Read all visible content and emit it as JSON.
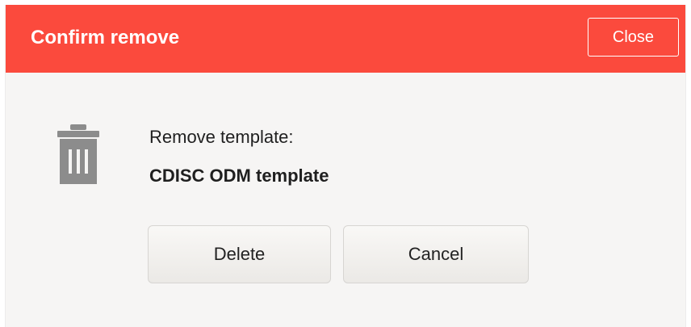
{
  "dialog": {
    "title": "Confirm remove",
    "close_label": "Close",
    "prompt": "Remove template:",
    "item_name": "CDISC ODM template",
    "delete_label": "Delete",
    "cancel_label": "Cancel",
    "icon": "trash-icon"
  },
  "colors": {
    "header_bg": "#fb4a3d",
    "body_bg": "#f6f5f4",
    "icon": "#8c8c8c"
  }
}
